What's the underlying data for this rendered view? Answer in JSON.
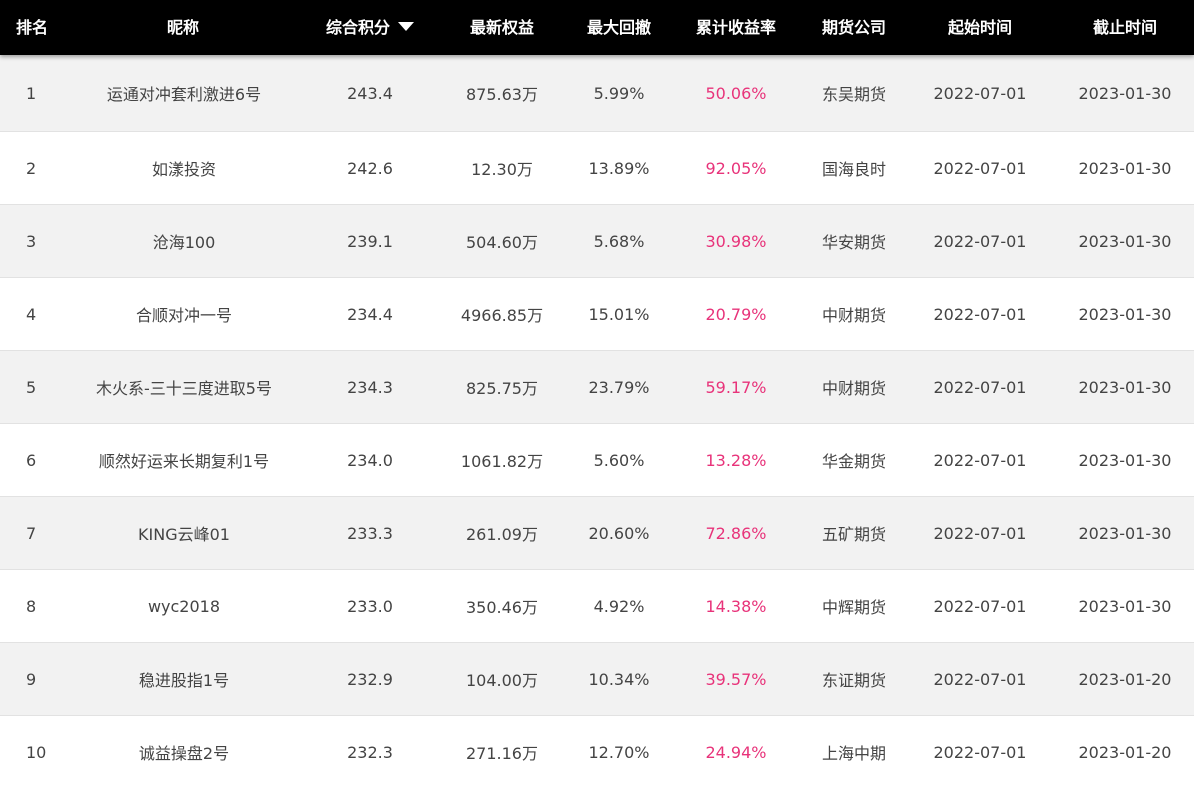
{
  "table": {
    "headers": {
      "rank": "排名",
      "nickname": "昵称",
      "score": "综合积分",
      "equity": "最新权益",
      "drawdown": "最大回撤",
      "return": "累计收益率",
      "company": "期货公司",
      "start": "起始时间",
      "end": "截止时间"
    },
    "sort_icon": "caret-down-icon",
    "accent_color": "#e8337a",
    "rows": [
      {
        "rank": "1",
        "nickname": "运通对冲套利激进6号",
        "score": "243.4",
        "equity": "875.63万",
        "drawdown": "5.99%",
        "return": "50.06%",
        "company": "东吴期货",
        "start": "2022-07-01",
        "end": "2023-01-30"
      },
      {
        "rank": "2",
        "nickname": "如漾投资",
        "score": "242.6",
        "equity": "12.30万",
        "drawdown": "13.89%",
        "return": "92.05%",
        "company": "国海良时",
        "start": "2022-07-01",
        "end": "2023-01-30"
      },
      {
        "rank": "3",
        "nickname": "沧海100",
        "score": "239.1",
        "equity": "504.60万",
        "drawdown": "5.68%",
        "return": "30.98%",
        "company": "华安期货",
        "start": "2022-07-01",
        "end": "2023-01-30"
      },
      {
        "rank": "4",
        "nickname": "合顺对冲一号",
        "score": "234.4",
        "equity": "4966.85万",
        "drawdown": "15.01%",
        "return": "20.79%",
        "company": "中财期货",
        "start": "2022-07-01",
        "end": "2023-01-30"
      },
      {
        "rank": "5",
        "nickname": "木火系-三十三度进取5号",
        "score": "234.3",
        "equity": "825.75万",
        "drawdown": "23.79%",
        "return": "59.17%",
        "company": "中财期货",
        "start": "2022-07-01",
        "end": "2023-01-30"
      },
      {
        "rank": "6",
        "nickname": "顺然好运来长期复利1号",
        "score": "234.0",
        "equity": "1061.82万",
        "drawdown": "5.60%",
        "return": "13.28%",
        "company": "华金期货",
        "start": "2022-07-01",
        "end": "2023-01-30"
      },
      {
        "rank": "7",
        "nickname": "KING云峰01",
        "score": "233.3",
        "equity": "261.09万",
        "drawdown": "20.60%",
        "return": "72.86%",
        "company": "五矿期货",
        "start": "2022-07-01",
        "end": "2023-01-30"
      },
      {
        "rank": "8",
        "nickname": "wyc2018",
        "score": "233.0",
        "equity": "350.46万",
        "drawdown": "4.92%",
        "return": "14.38%",
        "company": "中辉期货",
        "start": "2022-07-01",
        "end": "2023-01-30"
      },
      {
        "rank": "9",
        "nickname": "稳进股指1号",
        "score": "232.9",
        "equity": "104.00万",
        "drawdown": "10.34%",
        "return": "39.57%",
        "company": "东证期货",
        "start": "2022-07-01",
        "end": "2023-01-20"
      },
      {
        "rank": "10",
        "nickname": "诚益操盘2号",
        "score": "232.3",
        "equity": "271.16万",
        "drawdown": "12.70%",
        "return": "24.94%",
        "company": "上海中期",
        "start": "2022-07-01",
        "end": "2023-01-20"
      }
    ]
  }
}
